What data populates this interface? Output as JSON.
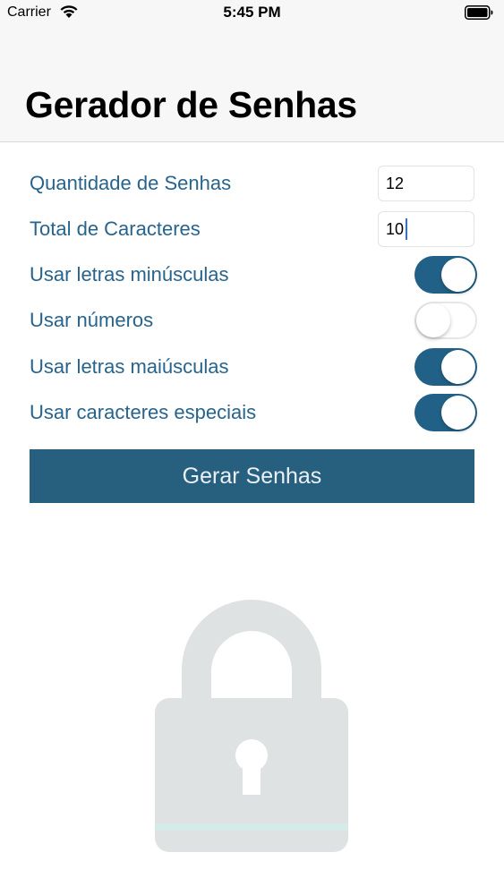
{
  "status_bar": {
    "carrier": "Carrier",
    "time": "5:45 PM"
  },
  "header": {
    "title": "Gerador de Senhas"
  },
  "form": {
    "quantity": {
      "label": "Quantidade de Senhas",
      "value": "12"
    },
    "length": {
      "label": "Total de Caracteres",
      "value": "10"
    },
    "toggles": [
      {
        "label": "Usar letras minúsculas",
        "on": true
      },
      {
        "label": "Usar números",
        "on": false
      },
      {
        "label": "Usar letras maiúsculas",
        "on": true
      },
      {
        "label": "Usar caracteres especiais",
        "on": true
      }
    ],
    "generate_label": "Gerar Senhas"
  },
  "colors": {
    "accent": "#27648d",
    "button": "#275f7f",
    "toggle_on": "#226187",
    "lock": "#dfe2e3"
  },
  "icons": {
    "lock": "lock-icon"
  }
}
